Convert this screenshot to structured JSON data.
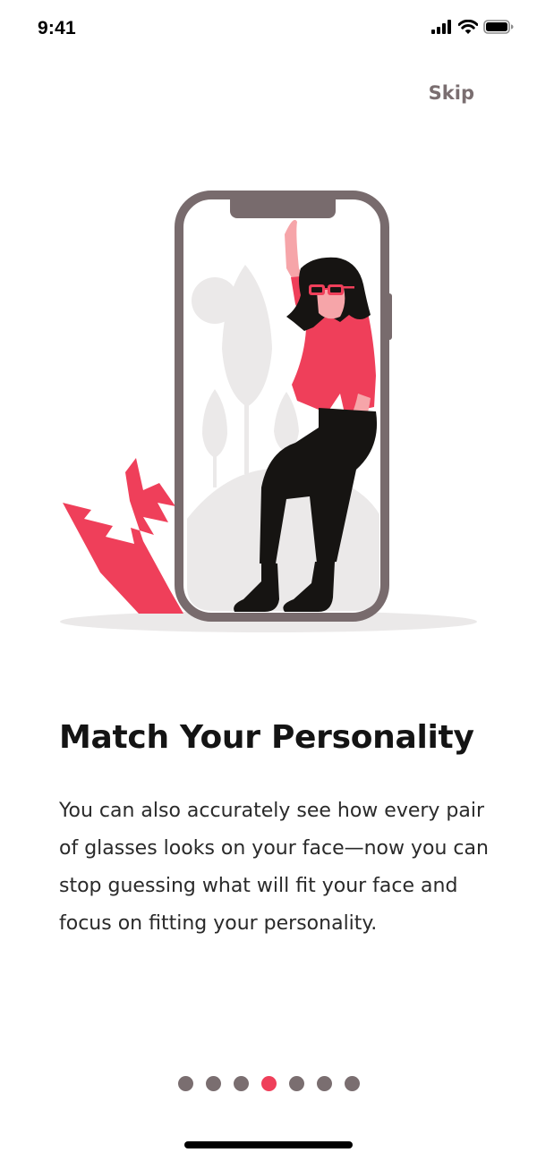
{
  "status_bar": {
    "time": "9:41"
  },
  "header": {
    "skip_label": "Skip"
  },
  "onboarding": {
    "title": "Match Your Personality",
    "body": "You can also accurately see how every pair of glasses looks on your face—now you can stop guessing what will fit your face and focus on fitting your personality."
  },
  "pager": {
    "total": 7,
    "active_index": 3
  },
  "colors": {
    "accent": "#ef3f5a",
    "phone_frame": "#786b6d",
    "dot_inactive": "#7a6e70",
    "background": "#ffffff"
  },
  "icons": [
    "signal-icon",
    "wifi-icon",
    "battery-icon"
  ]
}
